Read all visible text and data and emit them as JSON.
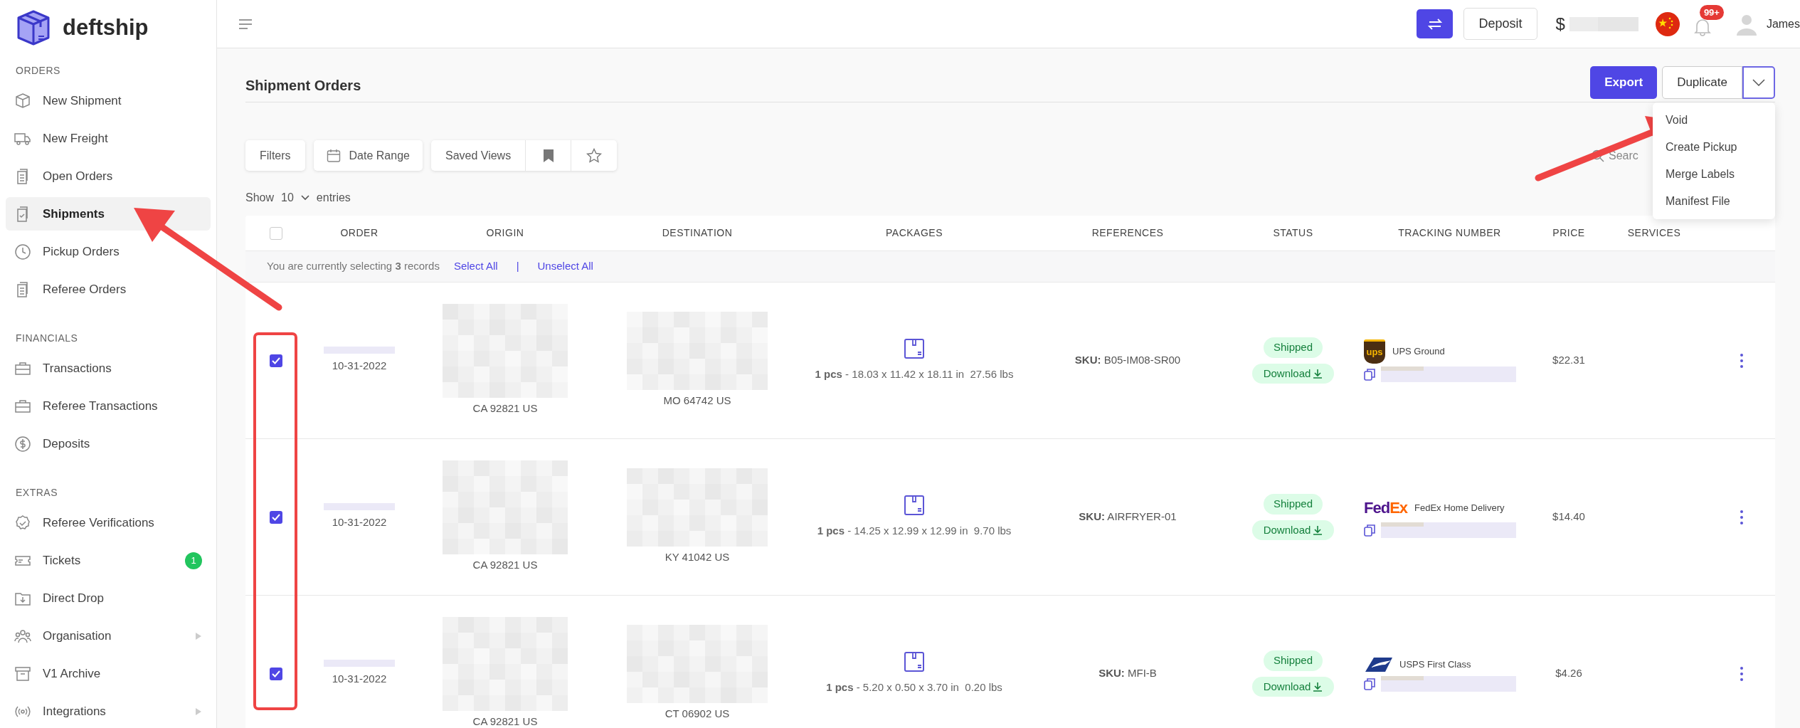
{
  "sidebar": {
    "logo": "deftship",
    "sections": [
      {
        "heading": "ORDERS",
        "items": [
          {
            "label": "New Shipment",
            "selected": false
          },
          {
            "label": "New Freight",
            "selected": false
          },
          {
            "label": "Open Orders",
            "selected": false
          },
          {
            "label": "Shipments",
            "selected": true
          },
          {
            "label": "Pickup Orders",
            "selected": false
          },
          {
            "label": "Referee Orders",
            "selected": false
          }
        ]
      },
      {
        "heading": "FINANCIALS",
        "items": [
          {
            "label": "Transactions",
            "selected": false
          },
          {
            "label": "Referee Transactions",
            "selected": false
          },
          {
            "label": "Deposits",
            "selected": false
          }
        ]
      },
      {
        "heading": "EXTRAS",
        "items": [
          {
            "label": "Referee Verifications",
            "selected": false
          },
          {
            "label": "Tickets",
            "selected": false,
            "badge": "1"
          },
          {
            "label": "Direct Drop",
            "selected": false
          },
          {
            "label": "Organisation",
            "selected": false,
            "expandable": true
          },
          {
            "label": "V1 Archive",
            "selected": false
          },
          {
            "label": "Integrations",
            "selected": false,
            "expandable": true
          }
        ]
      }
    ]
  },
  "top_bar": {
    "deposit_button": "Deposit",
    "balance_symbol": "$",
    "notifications_badge": "99+",
    "user_name": "James"
  },
  "page": {
    "title": "Shipment Orders",
    "export_button": "Export",
    "duplicate_button": "Duplicate",
    "dropdown_items": [
      "Void",
      "Create Pickup",
      "Merge Labels",
      "Manifest File"
    ],
    "filters": {
      "filters_button": "Filters",
      "date_range_button": "Date Range",
      "saved_views_button": "Saved Views",
      "search_placeholder": "Searc"
    },
    "show_entries": {
      "show": "Show",
      "count": "10",
      "entries": "entries"
    }
  },
  "table": {
    "select_all_checked": false,
    "columns": [
      "ORDER",
      "ORIGIN",
      "DESTINATION",
      "PACKAGES",
      "REFERENCES",
      "STATUS",
      "TRACKING NUMBER",
      "PRICE",
      "SERVICES"
    ],
    "selection_bar": {
      "message": "You are currently selecting **3** records",
      "select_all": "Select All",
      "separator": "|",
      "unselect_all": "Unselect All"
    },
    "rows": [
      {
        "checked": true,
        "date": "10-31-2022",
        "origin": "CA 92821 US",
        "destination": "MO 64742 US",
        "packages": "**1 pcs** - 18.03 x 11.42 x 18.11 in  27.56 lbs",
        "references": "**SKU:** B05-IM08-SR00",
        "status": "Shipped",
        "download": "Download",
        "carrier": {
          "kind": "ups",
          "logo_text": "ups",
          "service": "UPS Ground"
        },
        "price": "$22.31"
      },
      {
        "checked": true,
        "date": "10-31-2022",
        "origin": "CA 92821 US",
        "destination": "KY 41042 US",
        "packages": "**1 pcs** - 14.25 x 12.99 x 12.99 in  9.70 lbs",
        "references": "**SKU:** AIRFRYER-01",
        "status": "Shipped",
        "download": "Download",
        "carrier": {
          "kind": "fedex",
          "logo_text": "FedEx",
          "service": "FedEx Home Delivery"
        },
        "price": "$14.40"
      },
      {
        "checked": true,
        "date": "10-31-2022",
        "origin": "CA 92821 US",
        "destination": "CT 06902 US",
        "packages": "**1 pcs** - 5.20 x 0.50 x 3.70 in  0.20 lbs",
        "references": "**SKU:** MFI-B",
        "status": "Shipped",
        "download": "Download",
        "carrier": {
          "kind": "usps",
          "service": "USPS First Class"
        },
        "price": "$4.26"
      }
    ]
  }
}
